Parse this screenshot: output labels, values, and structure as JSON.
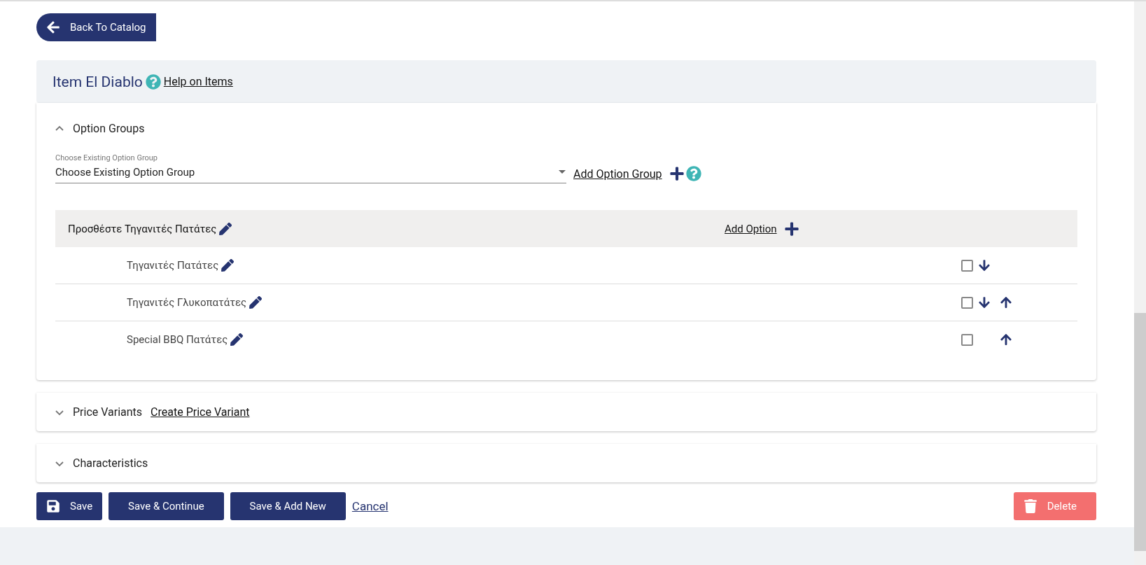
{
  "back_button": {
    "label": "Back To Catalog"
  },
  "header": {
    "title": "Item El Diablo",
    "help_link": "Help on Items"
  },
  "sections": [
    {
      "title": "Option Groups",
      "expanded": true,
      "select": {
        "label": "Choose Existing Option Group",
        "value": "Choose Existing Option Group"
      },
      "add_group_link": "Add Option Group",
      "group": {
        "name": "Προσθέστε Τηγανιτές Πατάτες",
        "add_option_link": "Add Option",
        "options": [
          {
            "name": "Τηγανιτές Πατάτες",
            "checked": false,
            "can_move_down": true,
            "can_move_up": false
          },
          {
            "name": "Τηγανιτές Γλυκοπατάτες",
            "checked": false,
            "can_move_down": true,
            "can_move_up": true
          },
          {
            "name": "Special BBQ Πατάτες",
            "checked": false,
            "can_move_down": false,
            "can_move_up": true
          }
        ]
      }
    },
    {
      "title": "Price Variants",
      "expanded": false,
      "link": "Create Price Variant"
    },
    {
      "title": "Characteristics",
      "expanded": false
    }
  ],
  "actions": {
    "save": "Save",
    "save_continue": "Save & Continue",
    "save_add_new": "Save & Add New",
    "cancel": "Cancel",
    "delete": "Delete"
  }
}
